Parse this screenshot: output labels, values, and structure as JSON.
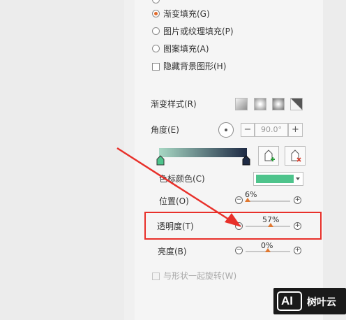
{
  "fill_options": [
    {
      "label": "渐变填充(G)",
      "checked": true
    },
    {
      "label": "图片或纹理填充(P)",
      "checked": false
    },
    {
      "label": "图案填充(A)",
      "checked": false
    }
  ],
  "hide_background": {
    "label": "隐藏背景图形(H)",
    "checked": false
  },
  "gradient_style": {
    "label": "渐变样式(R)"
  },
  "angle": {
    "label": "角度(E)",
    "value": "90.0°",
    "minus": "−",
    "plus": "+"
  },
  "stop_color": {
    "label": "色标颜色(C)",
    "color": "#4ec48c"
  },
  "gradient": {
    "start": "#a8d8c4",
    "end": "#1e2a44"
  },
  "sliders": [
    {
      "label": "位置(O)",
      "value": "6%",
      "fraction": 0.06
    },
    {
      "label": "透明度(T)",
      "value": "57%",
      "fraction": 0.57
    },
    {
      "label": "亮度(B)",
      "value": "0%",
      "fraction": 0.5
    }
  ],
  "rotate": {
    "label": "与形状一起旋转(W)",
    "checked": false
  },
  "colors": {
    "accent": "#e06b2c",
    "highlight": "#e8302a"
  },
  "watermark": {
    "brand": "AI",
    "name": "树叶云"
  }
}
